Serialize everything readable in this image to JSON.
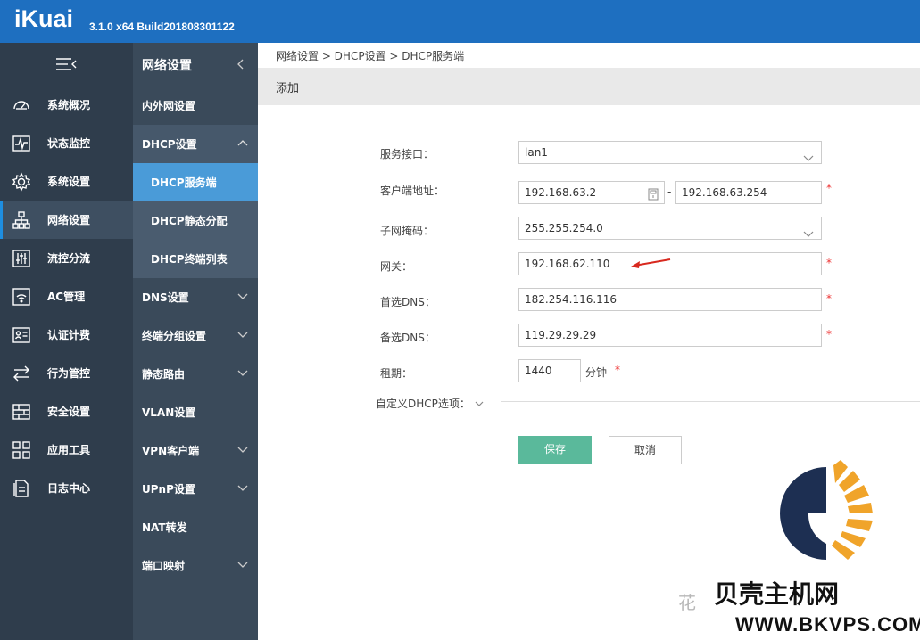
{
  "header": {
    "logo": "iKuai",
    "version": "3.1.0 x64 Build201808301122"
  },
  "sidebar": {
    "items": [
      {
        "label": "系统概况",
        "icon": "gauge-icon"
      },
      {
        "label": "状态监控",
        "icon": "pulse-icon"
      },
      {
        "label": "系统设置",
        "icon": "gear-icon"
      },
      {
        "label": "网络设置",
        "icon": "network-icon"
      },
      {
        "label": "流控分流",
        "icon": "sliders-icon"
      },
      {
        "label": "AC管理",
        "icon": "wifi-icon"
      },
      {
        "label": "认证计费",
        "icon": "id-card-icon"
      },
      {
        "label": "行为管控",
        "icon": "arrows-icon"
      },
      {
        "label": "安全设置",
        "icon": "grid-icon"
      },
      {
        "label": "应用工具",
        "icon": "apps-icon"
      },
      {
        "label": "日志中心",
        "icon": "doc-icon"
      }
    ],
    "active": "网络设置"
  },
  "subnav": {
    "title": "网络设置",
    "items": {
      "nat": "内外网设置",
      "dhcp": "DHCP设置",
      "dhcp_server": "DHCP服务端",
      "dhcp_static": "DHCP静态分配",
      "dhcp_clients": "DHCP终端列表",
      "dns": "DNS设置",
      "group": "终端分组设置",
      "route": "静态路由",
      "vlan": "VLAN设置",
      "vpn": "VPN客户端",
      "upnp": "UPnP设置",
      "natfwd": "NAT转发",
      "portmap": "端口映射"
    }
  },
  "breadcrumb": "网络设置 > DHCP设置 > DHCP服务端",
  "page_title": "添加",
  "form": {
    "interface_label": "服务接口：",
    "interface_value": "lan1",
    "client_addr_label": "客户端地址：",
    "client_addr_start": "192.168.63.2",
    "client_addr_end": "192.168.63.254",
    "subnet_label": "子网掩码：",
    "subnet_value": "255.255.254.0",
    "gateway_label": "网关：",
    "gateway_value": "192.168.62.110",
    "dns1_label": "首选DNS：",
    "dns1_value": "182.254.116.116",
    "dns2_label": "备选DNS：",
    "dns2_value": "119.29.29.29",
    "lease_label": "租期：",
    "lease_value": "1440",
    "lease_unit": "分钟",
    "custom_label": "自定义DHCP选项：",
    "required": "*",
    "dash": "-"
  },
  "buttons": {
    "save": "保存",
    "cancel": "取消"
  },
  "watermark": {
    "text": "贝壳主机网",
    "url": "WWW.BKVPS.COM",
    "faint": "花"
  },
  "colors": {
    "topbar": "#1e6fc0",
    "accent": "#4a9bd8",
    "save": "#5ab99b",
    "required": "#e33333"
  }
}
